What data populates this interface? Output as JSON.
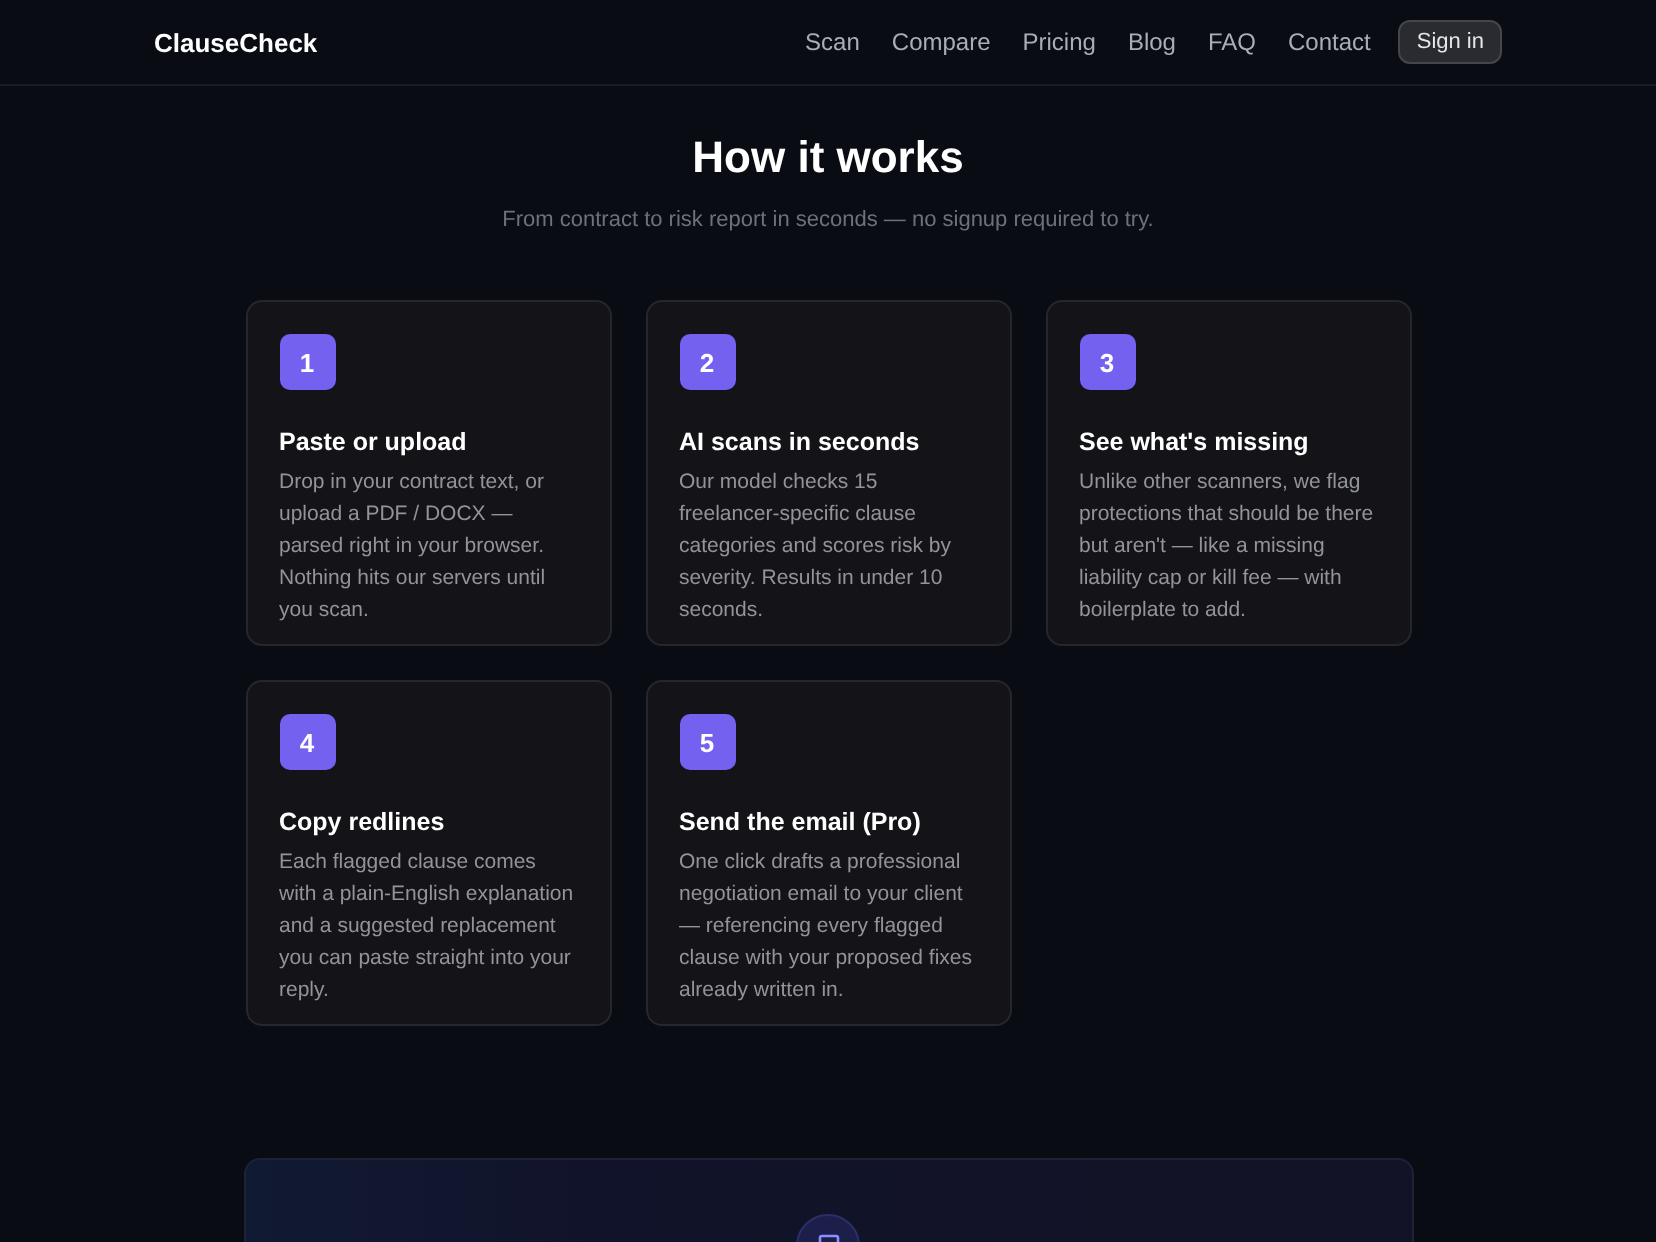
{
  "header": {
    "logo": "ClauseCheck",
    "nav": [
      "Scan",
      "Compare",
      "Pricing",
      "Blog",
      "FAQ",
      "Contact"
    ],
    "sign_in": "Sign in"
  },
  "section": {
    "title": "How it works",
    "subtitle": "From contract to risk report in seconds — no signup required to try."
  },
  "steps": [
    {
      "number": "1",
      "title": "Paste or upload",
      "text": "Drop in your contract text, or upload a PDF / DOCX — parsed right in your browser. Nothing hits our servers until you scan."
    },
    {
      "number": "2",
      "title": "AI scans in seconds",
      "text": "Our model checks 15 freelancer-specific clause categories and scores risk by severity. Results in under 10 seconds."
    },
    {
      "number": "3",
      "title": "See what's missing",
      "text": "Unlike other scanners, we flag protections that should be there but aren't — like a missing liability cap or kill fee — with boilerplate to add."
    },
    {
      "number": "4",
      "title": "Copy redlines",
      "text": "Each flagged clause comes with a plain-English explanation and a suggested replacement you can paste straight into your reply."
    },
    {
      "number": "5",
      "title": "Send the email (Pro)",
      "text": "One click drafts a professional negotiation email to your client — referencing every flagged clause with your proposed fixes already written in."
    }
  ]
}
